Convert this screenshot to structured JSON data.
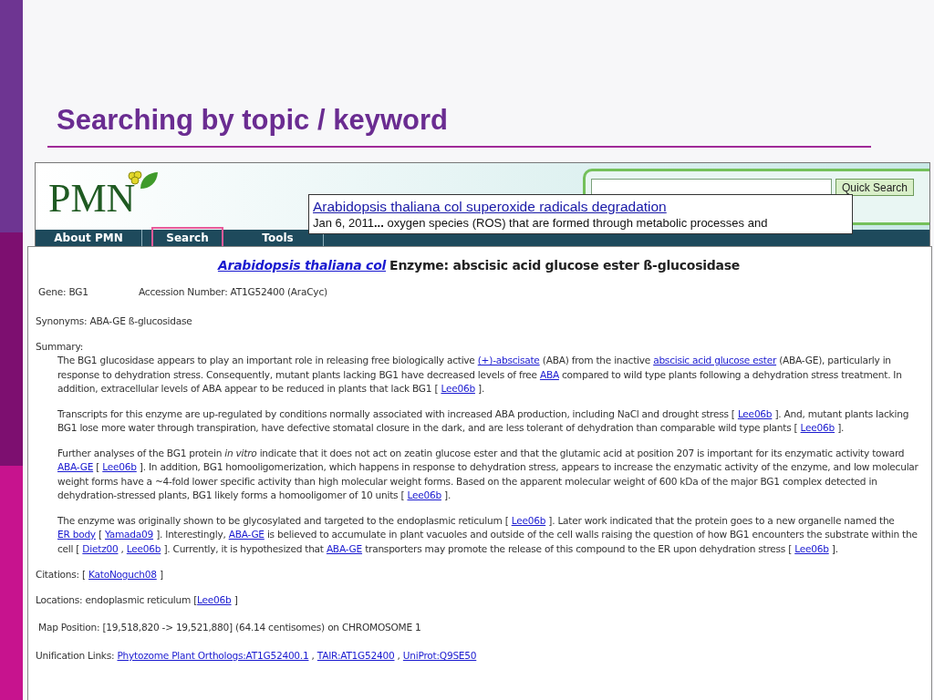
{
  "slide": {
    "title": "Searching by topic / keyword"
  },
  "pmn_header": {
    "logo": "PMN",
    "search_button": "Quick Search",
    "nav": [
      {
        "label": "About PMN",
        "selected": false
      },
      {
        "label": "Search",
        "selected": true
      },
      {
        "label": "Tools",
        "selected": false
      }
    ]
  },
  "search_result": {
    "title": "Arabidopsis thaliana col superoxide radicals degradation",
    "snippet": "Jan 6, 2011**...** oxygen species (ROS) that are formed through metabolic processes and"
  },
  "enzyme_page": {
    "heading": {
      "organism": "Arabidopsis thaliana col",
      "title": "Enzyme: abscisic acid glucose ester ß-glucosidase"
    },
    "gene": "Gene: BG1",
    "accession": "Accession Number: AT1G52400 (AraCyc)",
    "synonyms": "Synonyms: ABA-GE ß-glucosidase",
    "summary_label": "Summary:",
    "summary": [
      [
        {
          "kind": "text",
          "text": "The BG1 glucosidase appears to play an important role in releasing free biologically active "
        },
        {
          "kind": "link",
          "text": "(+)-abscisate"
        },
        {
          "kind": "text",
          "text": " (ABA) from the inactive "
        },
        {
          "kind": "link",
          "text": "abscisic acid glucose ester"
        },
        {
          "kind": "text",
          "text": " (ABA-GE), particularly in response to dehydration stress. Consequently, mutant plants lacking BG1 have decreased levels of free "
        },
        {
          "kind": "link",
          "text": "ABA"
        },
        {
          "kind": "text",
          "text": " compared to wild type plants following a dehydration stress treatment. In addition, extracellular levels of ABA appear to be reduced in plants that lack BG1 [ "
        },
        {
          "kind": "link",
          "text": "Lee06b"
        },
        {
          "kind": "text",
          "text": " ]."
        }
      ],
      [
        {
          "kind": "text",
          "text": "Transcripts for this enzyme are up-regulated by conditions normally associated with increased ABA production, including NaCl and drought stress [ "
        },
        {
          "kind": "link",
          "text": "Lee06b"
        },
        {
          "kind": "text",
          "text": " ]. And, mutant plants lacking BG1 lose more water through transpiration, have defective stomatal closure in the dark, and are less tolerant of dehydration than comparable wild type plants [ "
        },
        {
          "kind": "link",
          "text": "Lee06b"
        },
        {
          "kind": "text",
          "text": " ]."
        }
      ],
      [
        {
          "kind": "text",
          "text": "Further analyses of the BG1 protein *in vitro* indicate that it does not act on zeatin glucose ester and that the glutamic acid at position 207 is important for its enzymatic activity toward "
        },
        {
          "kind": "link",
          "text": "ABA-GE"
        },
        {
          "kind": "text",
          "text": " [ "
        },
        {
          "kind": "link",
          "text": "Lee06b"
        },
        {
          "kind": "text",
          "text": " ]. In addition, BG1 homooligomerization, which happens in response to dehydration stress, appears to increase the enzymatic activity of the enzyme, and low molecular weight forms have a ~4-fold lower specific activity than high molecular weight forms. Based on the apparent molecular weight of 600 kDa of the major BG1 complex detected in dehydration-stressed plants, BG1 likely forms a homooligomer of 10 units [ "
        },
        {
          "kind": "link",
          "text": "Lee06b"
        },
        {
          "kind": "text",
          "text": " ]."
        }
      ],
      [
        {
          "kind": "text",
          "text": "The enzyme was originally shown to be glycosylated and targeted to the endoplasmic reticulum [ "
        },
        {
          "kind": "link",
          "text": "Lee06b"
        },
        {
          "kind": "text",
          "text": " ]. Later work indicated that the protein goes to a new organelle named the "
        },
        {
          "kind": "link",
          "text": "ER body"
        },
        {
          "kind": "text",
          "text": " [ "
        },
        {
          "kind": "link",
          "text": "Yamada09"
        },
        {
          "kind": "text",
          "text": " ]. Interestingly, "
        },
        {
          "kind": "link",
          "text": "ABA-GE"
        },
        {
          "kind": "text",
          "text": " is believed to accumulate in plant vacuoles and outside of the cell walls raising the question of how BG1 encounters the substrate within the cell [ "
        },
        {
          "kind": "link",
          "text": "Dietz00"
        },
        {
          "kind": "text",
          "text": " , "
        },
        {
          "kind": "link",
          "text": "Lee06b"
        },
        {
          "kind": "text",
          "text": " ]. Currently, it is hypothesized that "
        },
        {
          "kind": "link",
          "text": "ABA-GE"
        },
        {
          "kind": "text",
          "text": " transporters may promote the release of this compound to the ER upon dehydration stress [ "
        },
        {
          "kind": "link",
          "text": "Lee06b"
        },
        {
          "kind": "text",
          "text": " ]."
        }
      ]
    ],
    "citations": [
      {
        "kind": "text",
        "text": "Citations: [ "
      },
      {
        "kind": "link",
        "text": "KatoNoguch08"
      },
      {
        "kind": "text",
        "text": " ]"
      }
    ],
    "locations": [
      {
        "kind": "text",
        "text": "Locations: endoplasmic reticulum ["
      },
      {
        "kind": "link",
        "text": "Lee06b"
      },
      {
        "kind": "text",
        "text": " ]"
      }
    ],
    "map_position": "Map Position: [19,518,820 -> 19,521,880] (64.14 centisomes) on CHROMOSOME 1",
    "unification": [
      {
        "kind": "text",
        "text": "Unification Links: "
      },
      {
        "kind": "link",
        "text": "Phytozome Plant Orthologs:AT1G52400.1"
      },
      {
        "kind": "text",
        "text": " , "
      },
      {
        "kind": "link",
        "text": "TAIR:AT1G52400"
      },
      {
        "kind": "text",
        "text": " , "
      },
      {
        "kind": "link",
        "text": "UniProt:Q9SE50"
      }
    ]
  }
}
